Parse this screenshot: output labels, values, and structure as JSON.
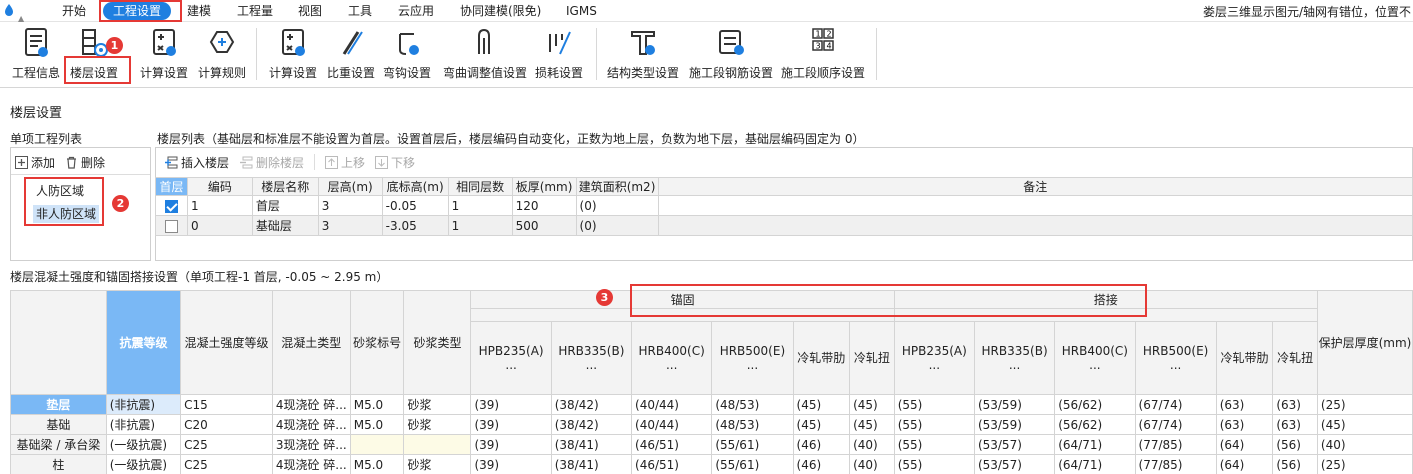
{
  "menubar": {
    "items": [
      "开始",
      "工程设置",
      "建模",
      "工程量",
      "视图",
      "工具",
      "云应用",
      "协同建模(限免)",
      "IGMS"
    ],
    "active_index": 1,
    "status_text": "娄层三维显示图元/轴网有错位，位置不"
  },
  "ribbon": {
    "buttons": [
      {
        "label": "工程信息",
        "icon": "project-info-icon"
      },
      {
        "label": "楼层设置",
        "icon": "floor-settings-icon"
      },
      {
        "label": "计算设置",
        "icon": "calc-settings-icon"
      },
      {
        "label": "计算规则",
        "icon": "calc-rules-icon"
      },
      {
        "label": "计算设置",
        "icon": "rebar-calc-settings-icon"
      },
      {
        "label": "比重设置",
        "icon": "density-settings-icon"
      },
      {
        "label": "弯钩设置",
        "icon": "hook-settings-icon"
      },
      {
        "label": "弯曲调整值设置",
        "icon": "bend-adjust-icon"
      },
      {
        "label": "损耗设置",
        "icon": "loss-settings-icon"
      },
      {
        "label": "结构类型设置",
        "icon": "structure-type-icon"
      },
      {
        "label": "施工段钢筋设置",
        "icon": "segment-rebar-icon"
      },
      {
        "label": "施工段顺序设置",
        "icon": "segment-order-icon"
      }
    ]
  },
  "annotations": {
    "badge1": "1",
    "badge2": "2",
    "badge3": "3"
  },
  "dialog": {
    "title": "楼层设置",
    "project_list_title": "单项工程列表",
    "add_label": "添加",
    "delete_label": "删除",
    "regions": [
      "人防区域",
      "非人防区域"
    ],
    "selected_region": 1,
    "floor_list_title": "楼层列表（基础层和标准层不能设置为首层。设置首层后，楼层编码自动变化，正数为地上层，负数为地下层，基础层编码固定为 0）",
    "floor_toolbar": {
      "insert": "插入楼层",
      "delete": "删除楼层",
      "up": "上移",
      "down": "下移"
    },
    "floor_table": {
      "headers": [
        "首层",
        "编码",
        "楼层名称",
        "层高(m)",
        "底标高(m)",
        "相同层数",
        "板厚(mm)",
        "建筑面积(m2)",
        "备注"
      ],
      "rows": [
        {
          "first": true,
          "code": "1",
          "name": "首层",
          "height": "3",
          "bottom": "-0.05",
          "same": "1",
          "thick": "120",
          "area": "(0)",
          "note": ""
        },
        {
          "first": false,
          "code": "0",
          "name": "基础层",
          "height": "3",
          "bottom": "-3.05",
          "same": "1",
          "thick": "500",
          "area": "(0)",
          "note": ""
        }
      ]
    },
    "concrete_title": "楼层混凝土强度和锚固搭接设置（单项工程-1  首层, -0.05 ~ 2.95 m）",
    "concrete_table": {
      "group_anchor": "锚固",
      "group_lap": "搭接",
      "headers": {
        "seismic": "抗震等级",
        "concrete_grade": "混凝土强度等级",
        "concrete_type": "混凝土类型",
        "mortar_grade": "砂浆标号",
        "mortar_type": "砂浆类型",
        "hpb235": "HPB235(A)",
        "hrb335": "HRB335(B)",
        "hrb400": "HRB400(C)",
        "hrb500": "HRB500(E)",
        "cold_ribbed": "冷轧带肋",
        "cold_twisted": "冷轧扭",
        "cover": "保护层厚度(mm)",
        "ellipsis": "..."
      },
      "rows": [
        {
          "name": "垫层",
          "seismic": "(非抗震)",
          "grade": "C15",
          "ctype": "4现浇砼 碎...",
          "mgrade": "M5.0",
          "mtype": "砂浆",
          "a": [
            "(39)",
            "(38/42)",
            "(40/44)",
            "(48/53)",
            "(45)",
            "(45)"
          ],
          "l": [
            "(55)",
            "(53/59)",
            "(56/62)",
            "(67/74)",
            "(63)",
            "(63)"
          ],
          "cover": "(25)"
        },
        {
          "name": "基础",
          "seismic": "(非抗震)",
          "grade": "C20",
          "ctype": "4现浇砼 碎...",
          "mgrade": "M5.0",
          "mtype": "砂浆",
          "a": [
            "(39)",
            "(38/42)",
            "(40/44)",
            "(48/53)",
            "(45)",
            "(45)"
          ],
          "l": [
            "(55)",
            "(53/59)",
            "(56/62)",
            "(67/74)",
            "(63)",
            "(63)"
          ],
          "cover": "(45)"
        },
        {
          "name": "基础梁 / 承台梁",
          "seismic": "(一级抗震)",
          "grade": "C25",
          "ctype": "3现浇砼 碎...",
          "mgrade": "",
          "mtype": "",
          "a": [
            "(39)",
            "(38/41)",
            "(46/51)",
            "(55/61)",
            "(46)",
            "(40)"
          ],
          "l": [
            "(55)",
            "(53/57)",
            "(64/71)",
            "(77/85)",
            "(64)",
            "(56)"
          ],
          "cover": "(40)"
        },
        {
          "name": "柱",
          "seismic": "(一级抗震)",
          "grade": "C25",
          "ctype": "4现浇砼 碎...",
          "mgrade": "M5.0",
          "mtype": "砂浆",
          "a": [
            "(39)",
            "(38/41)",
            "(46/51)",
            "(55/61)",
            "(46)",
            "(40)"
          ],
          "l": [
            "(55)",
            "(53/57)",
            "(64/71)",
            "(77/85)",
            "(64)",
            "(56)"
          ],
          "cover": "(25)"
        }
      ]
    }
  }
}
